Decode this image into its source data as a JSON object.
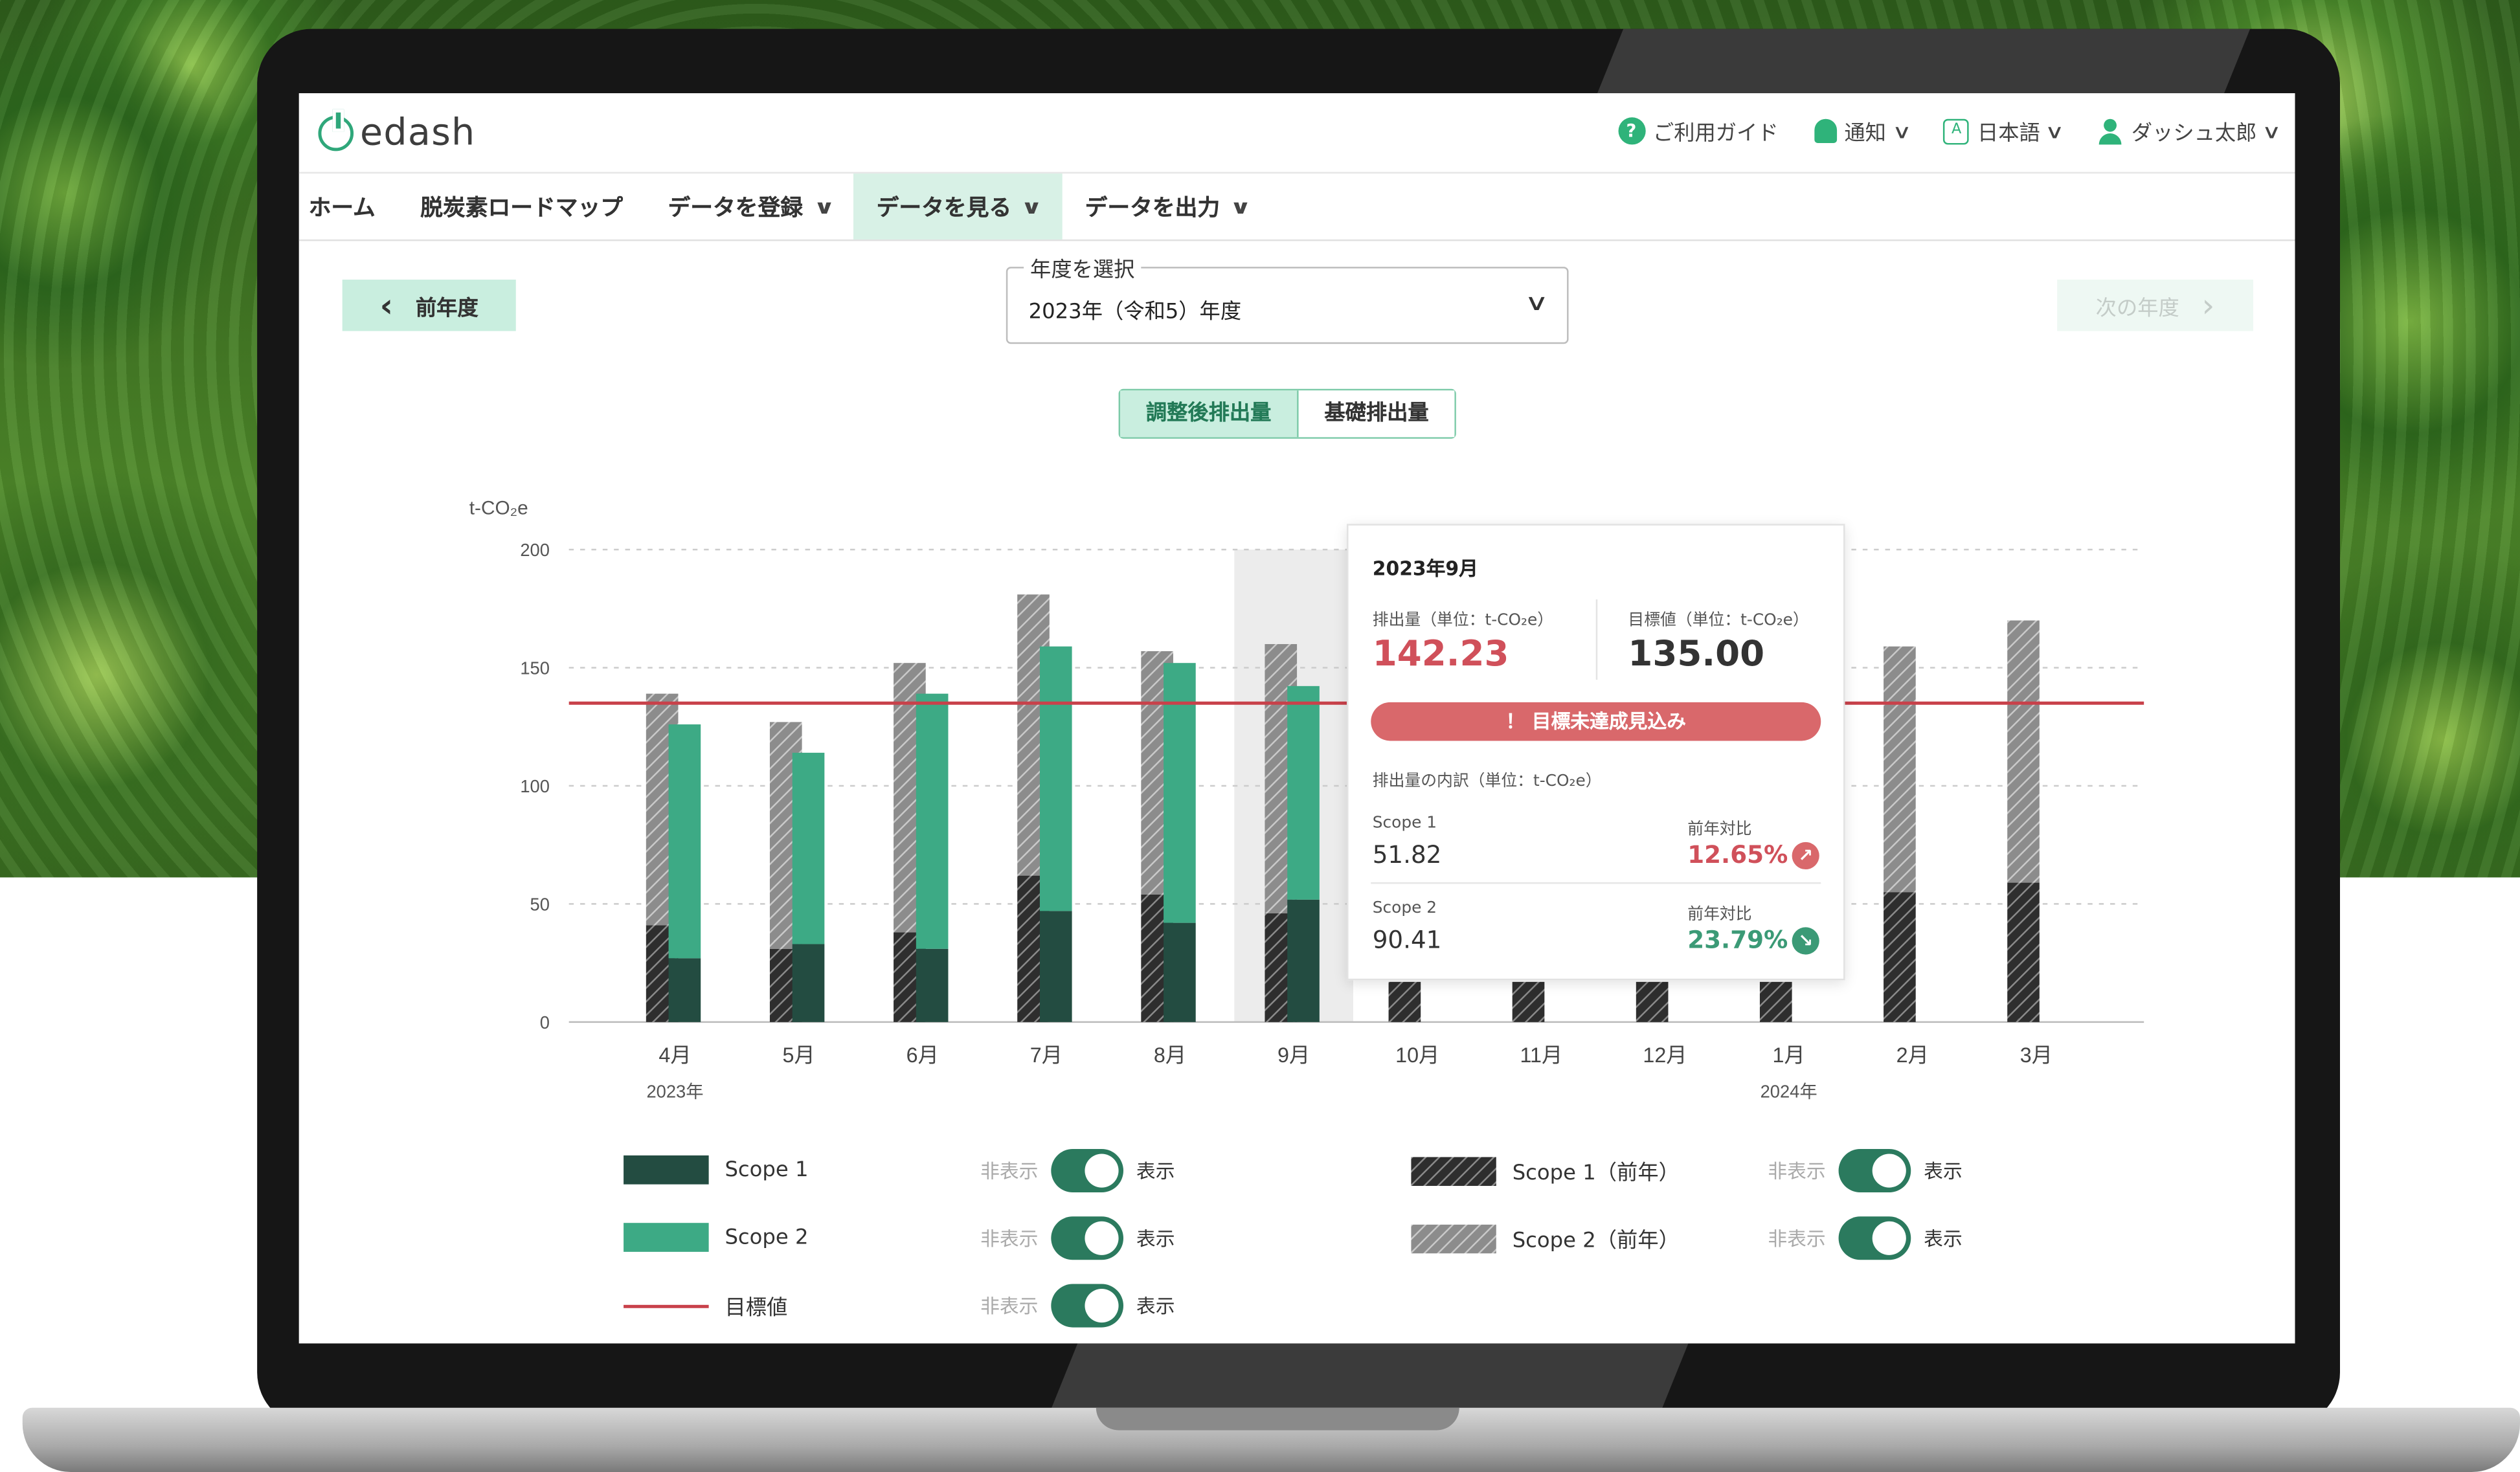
{
  "app": {
    "logo_text": "edash",
    "colors": {
      "brand": "#2fa77a",
      "scope1": "#234c41",
      "scope2": "#3daa85",
      "target": "#c8414a",
      "warn": "#d9686b",
      "good": "#3b9a76"
    }
  },
  "top_menu": {
    "guide": "ご利用ガイド",
    "guide_icon": "?",
    "notify": "通知",
    "language": "日本語",
    "language_icon": "A",
    "user": "ダッシュ太郎",
    "chevron": "∨"
  },
  "nav": {
    "home": "ホーム",
    "roadmap": "脱炭素ロードマップ",
    "register": "データを登録",
    "view": "データを見る",
    "export": "データを出力"
  },
  "controls": {
    "prev_year": "前年度",
    "prev_arrow": "‹",
    "next_year": "次の年度",
    "next_arrow": "›",
    "year_legend": "年度を選択",
    "year_value": "2023年（令和5）年度",
    "seg_adjusted": "調整後排出量",
    "seg_base": "基礎排出量"
  },
  "chart_data": {
    "type": "bar",
    "ylabel": "t-CO₂e",
    "ylim": [
      0,
      200
    ],
    "yticks": [
      "0",
      "50",
      "100",
      "150",
      "200"
    ],
    "categories": [
      "4月",
      "5月",
      "6月",
      "7月",
      "8月",
      "9月",
      "10月",
      "11月",
      "12月",
      "1月",
      "2月",
      "3月"
    ],
    "year_labels": [
      {
        "index": 0,
        "text": "2023年"
      },
      {
        "index": 9,
        "text": "2024年"
      }
    ],
    "target": 135,
    "highlight_index": 5,
    "series": [
      {
        "name": "Scope 1",
        "values": [
          27,
          33,
          31,
          47,
          42,
          51.82,
          null,
          null,
          null,
          null,
          null,
          null
        ]
      },
      {
        "name": "Scope 2",
        "values": [
          99,
          81,
          108,
          112,
          110,
          90.41,
          null,
          null,
          null,
          null,
          null,
          null
        ]
      },
      {
        "name": "Scope 1（前年）",
        "values": [
          41,
          31,
          38,
          62,
          54,
          46,
          17,
          17,
          17,
          17,
          55,
          59
        ]
      },
      {
        "name": "Scope 2（前年）",
        "values": [
          98,
          96,
          114,
          119,
          103,
          114,
          null,
          null,
          null,
          null,
          104,
          111
        ]
      }
    ]
  },
  "tooltip": {
    "date": "2023年9月",
    "emission_label": "排出量（単位：t-CO₂e）",
    "emission_value": "142.23",
    "target_label": "目標値（単位：t-CO₂e）",
    "target_value": "135.00",
    "warning": "！ 目標未達成見込み",
    "breakdown_label": "排出量の内訳（単位：t-CO₂e）",
    "scope1_label": "Scope 1",
    "scope1_value": "51.82",
    "scope1_yoy_label": "前年対比",
    "scope1_yoy": "12.65%",
    "scope1_arrow": "↗",
    "scope2_label": "Scope 2",
    "scope2_value": "90.41",
    "scope2_yoy_label": "前年対比",
    "scope2_yoy": "23.79%",
    "scope2_arrow": "↘"
  },
  "legend": {
    "hide": "非表示",
    "show": "表示",
    "scope1": "Scope 1",
    "scope2": "Scope 2",
    "target": "目標値",
    "scope1_prev": "Scope 1（前年）",
    "scope2_prev": "Scope 2（前年）"
  }
}
